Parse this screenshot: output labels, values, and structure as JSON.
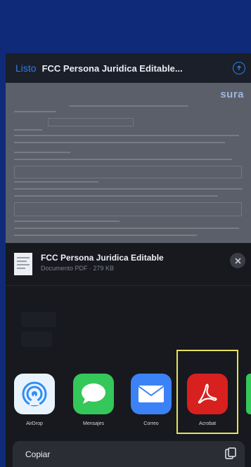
{
  "navbar": {
    "done_label": "Listo",
    "title": "FCC Persona Juridica Editable...",
    "action_icon": "share-circle-icon"
  },
  "document": {
    "logo_text": "sura"
  },
  "share_sheet": {
    "file_name": "FCC Persona Juridica Editable",
    "file_meta": "Documento PDF · 279 KB",
    "close_icon": "close-icon",
    "apps": [
      {
        "label": "AirDrop",
        "icon": "airdrop-icon",
        "color": "#2f8ef2"
      },
      {
        "label": "Mensajes",
        "icon": "messages-icon",
        "color": "#34c759"
      },
      {
        "label": "Correo",
        "icon": "mail-icon",
        "color": "#3b82f6"
      },
      {
        "label": "Acrobat",
        "icon": "acrobat-icon",
        "color": "#d8201f"
      }
    ],
    "copy_label": "Copiar",
    "copy_icon": "copy-icon"
  },
  "colors": {
    "background": "#0f2a78",
    "highlight": "#e5e35a",
    "accent": "#2f7de8"
  }
}
